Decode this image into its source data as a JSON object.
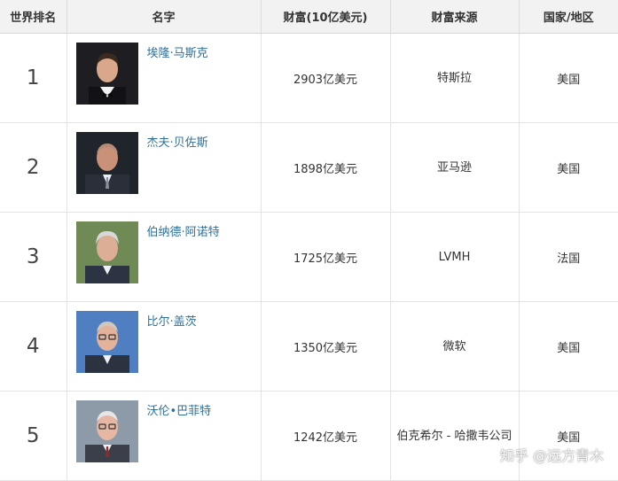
{
  "headers": {
    "rank": "世界排名",
    "name": "名字",
    "wealth": "财富(10亿美元)",
    "source": "财富来源",
    "country": "国家/地区"
  },
  "rows": [
    {
      "rank": "1",
      "name": "埃隆·马斯克",
      "wealth": "2903亿美元",
      "source": "特斯拉",
      "country": "美国"
    },
    {
      "rank": "2",
      "name": "杰夫·贝佐斯",
      "wealth": "1898亿美元",
      "source": "亚马逊",
      "country": "美国"
    },
    {
      "rank": "3",
      "name": "伯纳德·阿诺特",
      "wealth": "1725亿美元",
      "source": "LVMH",
      "country": "法国"
    },
    {
      "rank": "4",
      "name": "比尔·盖茨",
      "wealth": "1350亿美元",
      "source": "微软",
      "country": "美国"
    },
    {
      "rank": "5",
      "name": "沃伦•巴菲特",
      "wealth": "1242亿美元",
      "source": "伯克希尔 - 哈撒韦公司",
      "country": "美国"
    }
  ],
  "watermark": "知乎 @远方青木"
}
